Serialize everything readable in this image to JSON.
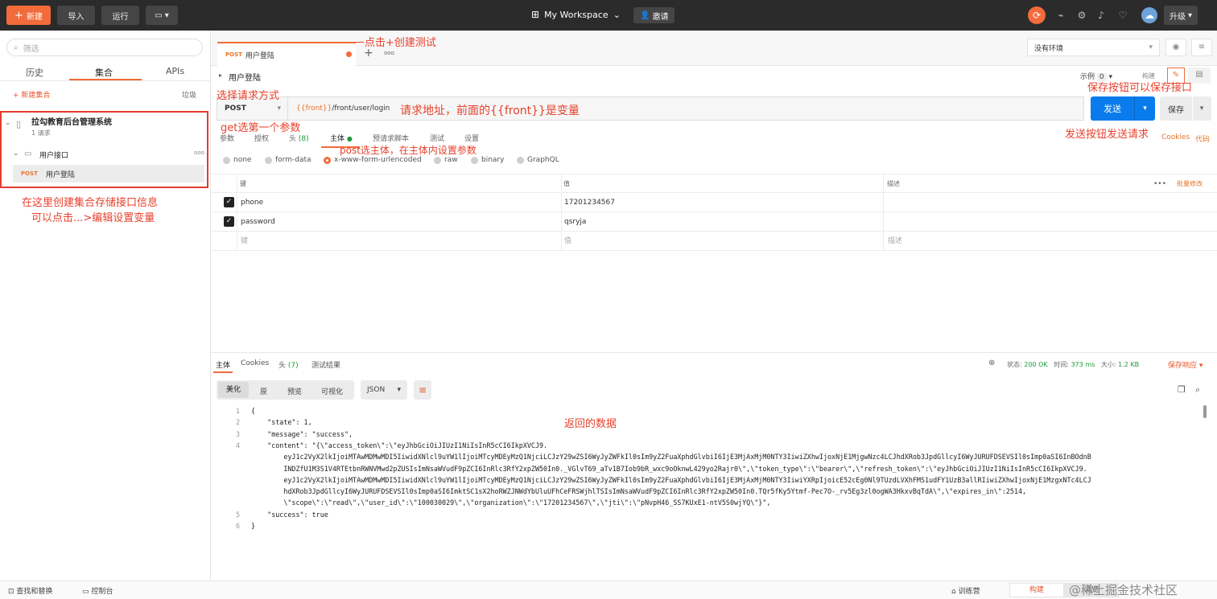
{
  "topbar": {
    "new": "新建",
    "import": "导入",
    "run": "运行",
    "workspace": "My Workspace",
    "invite": "邀请",
    "upgrade": "升级"
  },
  "sidebar": {
    "search_placeholder": "筛选",
    "tabs": [
      "历史",
      "集合",
      "APIs"
    ],
    "new_collection": "+ 新建集合",
    "trash": "垃圾",
    "collection": {
      "name": "拉勾教育后台管理系统",
      "count": "1 请求"
    },
    "folder": {
      "name": "用户接口",
      "more": "ooo"
    },
    "request": {
      "method": "POST",
      "name": "用户登陆"
    }
  },
  "tabs": {
    "request_tab": "用户登陆",
    "method": "POST",
    "add": "+",
    "more": "ooo",
    "env": "没有环境"
  },
  "request": {
    "title": "用户登陆",
    "examples_label": "示例",
    "examples_count": "0",
    "build": "构建",
    "method": "POST",
    "url_var": "{{front}}",
    "url_path": "/front/user/login",
    "send": "发送",
    "save": "保存",
    "cookies": "Cookies",
    "code": "代码"
  },
  "subtabs": [
    {
      "label": "参数"
    },
    {
      "label": "授权"
    },
    {
      "label": "头",
      "count": "(8)"
    },
    {
      "label": "主体"
    },
    {
      "label": "预请求脚本"
    },
    {
      "label": "测试"
    },
    {
      "label": "设置"
    }
  ],
  "body_types": [
    "none",
    "form-data",
    "x-www-form-urlencoded",
    "raw",
    "binary",
    "GraphQL"
  ],
  "params_table": {
    "headers": [
      "键",
      "值",
      "描述"
    ],
    "bulk_edit": "批量修改",
    "more": "•••",
    "rows": [
      {
        "key": "phone",
        "value": "17201234567"
      },
      {
        "key": "password",
        "value": "qsryja"
      }
    ],
    "placeholders": {
      "key": "键",
      "value": "值",
      "desc": "描述"
    }
  },
  "response": {
    "tabs": [
      "主体",
      "Cookies",
      "头",
      "测试结果"
    ],
    "headers_count": "(7)",
    "status_label": "状态:",
    "status": "200 OK",
    "time_label": "时间:",
    "time": "373 ms",
    "size_label": "大小:",
    "size": "1.2 KB",
    "save_response": "保存响应",
    "view_tabs": [
      "美化",
      "原",
      "预览",
      "可视化"
    ],
    "format": "JSON",
    "lines": [
      {
        "n": "1",
        "t": "{"
      },
      {
        "n": "2",
        "t": "    \"state\": 1,"
      },
      {
        "n": "3",
        "t": "    \"message\": \"success\","
      },
      {
        "n": "4",
        "t": "    \"content\": \"{\\\"access_token\\\":\\\"eyJhbGciOiJIUzI1NiIsInR5cCI6IkpXVCJ9."
      },
      {
        "n": "",
        "t": "        eyJ1c2VyX2lkIjoiMTAwMDMwMDI5IiwidXNlcl9uYW1lIjoiMTcyMDEyMzQ1NjciLCJzY29wZSI6WyJyZWFkIl0sIm9yZ2FuaXphdGlvbiI6IjE3MjAxMjM0NTY3IiwiZXhwIjoxNjE1MjgwNzc4LCJhdXRob3JpdGllcyI6WyJURUFDSEVSIl0sImp0aSI6InBOdnB"
      },
      {
        "n": "",
        "t": "        INDZfU1M3S1V4RTEtbnRWNVMwd2pZUSIsImNsaWVudF9pZCI6InRlc3RfY2xpZW50In0._VGlvT69_aTv1B7Iob9bR_wxc9oOknwL429yo2Rajr0\\\",\\\"token_type\\\":\\\"bearer\\\",\\\"refresh_token\\\":\\\"eyJhbGciOiJIUzI1NiIsInR5cCI6IkpXVCJ9."
      },
      {
        "n": "",
        "t": "        eyJ1c2VyX2lkIjoiMTAwMDMwMDI5IiwidXNlcl9uYW1lIjoiMTcyMDEyMzQ1NjciLCJzY29wZSI6WyJyZWFkIl0sIm9yZ2FuaXphdGlvbiI6IjE3MjAxMjM0NTY3IiwiYXRpIjoicE52cEg0Nl9TUzdLVXhFMS1udFY1UzB3allRIiwiZXhwIjoxNjE1MzgxNTc4LCJ"
      },
      {
        "n": "",
        "t": "        hdXRob3JpdGllcyI6WyJURUFDSEVSIl0sImp0aSI6ImktSC1sX2hoRWZJNWdYbUluUFhCeFRSWjhlTSIsImNsaWVudF9pZCI6InRlc3RfY2xpZW50In0.TQr5fKy5Ytmf-Pec7O-_rv5Eg3zl0ogWA3HkxvBqTdA\\\",\\\"expires_in\\\":2514,"
      },
      {
        "n": "",
        "t": "        \\\"scope\\\":\\\"read\\\",\\\"user_id\\\":\\\"100030029\\\",\\\"organization\\\":\\\"17201234567\\\",\\\"jti\\\":\\\"pNvpH46_SS7KUxE1-ntV5S0wjYQ\\\"}\","
      },
      {
        "n": "5",
        "t": "    \"success\": true"
      },
      {
        "n": "6",
        "t": "}"
      }
    ]
  },
  "statusbar": {
    "find": "查找和替换",
    "console": "控制台",
    "training": "训练营",
    "build": "构建",
    "browse": "浏览",
    "watermark": "@稀土掘金技术社区"
  },
  "annotations": {
    "a1": "点击+创建测试",
    "a2": "选择请求方式",
    "a3": "请求地址，前面的{{front}}是变量",
    "a4": "get选第一个参数",
    "a5": "post选主体，在主体内设置参数",
    "a6": "保存按钮可以保存接口",
    "a7": "发送按钮发送请求",
    "a8": "在这里创建集合存储接口信息",
    "a9": "可以点击...>编辑设置变量",
    "a10": "返回的数据"
  }
}
